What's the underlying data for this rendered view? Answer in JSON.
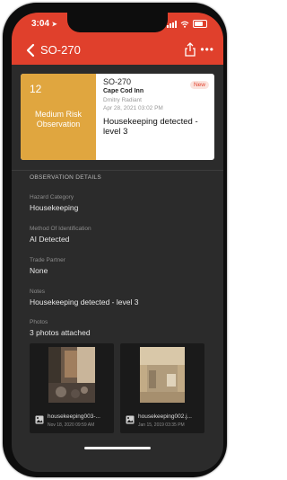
{
  "status": {
    "time": "3:04",
    "location_icon": "location-arrow-icon"
  },
  "nav": {
    "title": "SO-270",
    "back_icon": "chevron-left-icon",
    "share_icon": "share-icon",
    "more_icon": "more-horizontal-icon"
  },
  "card": {
    "risk_number": "12",
    "risk_label": "Medium Risk Observation",
    "risk_color": "#e0a63f",
    "id": "SO-270",
    "site": "Cape Cod Inn",
    "person": "Dmitry Radiant",
    "date": "Apr 28, 2021 03:02 PM",
    "title": "Housekeeping detected - level 3",
    "badge": "New"
  },
  "details": {
    "section_title": "OBSERVATION DETAILS",
    "fields": [
      {
        "label": "Hazard Category",
        "value": "Housekeeping"
      },
      {
        "label": "Method Of Identification",
        "value": "AI Detected"
      },
      {
        "label": "Trade Partner",
        "value": "None"
      },
      {
        "label": "Notes",
        "value": "Housekeeping detected - level 3"
      },
      {
        "label": "Photos",
        "value": "3 photos attached"
      }
    ]
  },
  "photos": [
    {
      "name": "housekeeping003-...",
      "date": "Nov 18, 2020 09:59 AM",
      "icon": "image-icon"
    },
    {
      "name": "housekeeping002.j...",
      "date": "Jan 15, 2019 03:35 PM",
      "icon": "image-icon"
    }
  ],
  "colors": {
    "header": "#e0402c",
    "background": "#2b2b2b",
    "badge_text": "#e0402c"
  }
}
